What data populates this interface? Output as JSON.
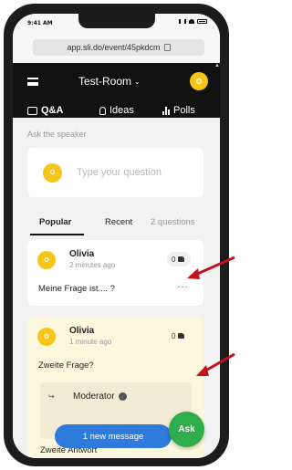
{
  "status_bar": {
    "time": "9:41 AM"
  },
  "browser": {
    "url": "app.sli.do/event/45pkdcm"
  },
  "header": {
    "room_title": "Test-Room",
    "avatar_initial": "O",
    "tabs": [
      {
        "label": "Q&A",
        "icon": "chat-icon",
        "active": true
      },
      {
        "label": "Ideas",
        "icon": "lightbulb-icon",
        "active": false
      },
      {
        "label": "Polls",
        "icon": "bar-chart-icon",
        "active": false
      }
    ]
  },
  "ask": {
    "label": "Ask the speaker",
    "avatar_initial": "O",
    "placeholder": "Type your question"
  },
  "filters": {
    "popular": "Popular",
    "recent": "Recent",
    "count": "2 questions",
    "active": "Popular"
  },
  "questions": [
    {
      "author": "Olivia",
      "time": "2 minutes ago",
      "likes": "0",
      "text": "Meine Frage ist.... ?",
      "avatar_initial": "O",
      "more": "···"
    },
    {
      "author": "Olivia",
      "time": "1 minute ago",
      "likes": "0",
      "text": "Zweite Frage?",
      "avatar_initial": "O",
      "reply": {
        "author": "Moderator",
        "text": "Zweite Antwort"
      }
    }
  ],
  "toast": {
    "label": "1 new message"
  },
  "fab": {
    "label": "Ask"
  },
  "colors": {
    "app_bar": "#111111",
    "avatar": "#f5c518",
    "toast": "#2f7bdc",
    "fab": "#2eae4a",
    "highlight_card": "#fdf8dd",
    "annotation_arrow": "#c0131b"
  }
}
